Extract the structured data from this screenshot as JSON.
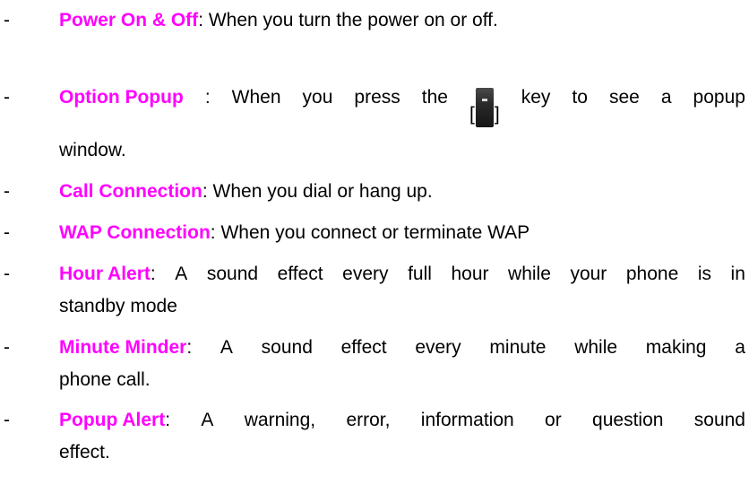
{
  "bullet": "-",
  "term_color": "#ff00ff",
  "items": [
    {
      "term": "Power On & Off",
      "rest": ": When you turn the power on or off."
    },
    {
      "term": "Option Popup",
      "rest_before_key": ": When you press the [",
      "key_icon": "soft-key-icon",
      "rest_after_key": "] key to see a popup",
      "continuation": "window."
    },
    {
      "term": "Call Connection",
      "rest": ": When you dial or hang up."
    },
    {
      "term": "WAP Connection",
      "rest": ": When you connect or terminate WAP"
    },
    {
      "term": "Hour Alert",
      "rest": ": A sound effect every full hour while your phone is in",
      "continuation": "standby mode"
    },
    {
      "term": "Minute Minder",
      "rest": ": A sound effect every minute while making a",
      "continuation": "phone call."
    },
    {
      "term": "Popup Alert",
      "rest": ": A warning, error, information or question sound",
      "continuation": "effect."
    }
  ]
}
